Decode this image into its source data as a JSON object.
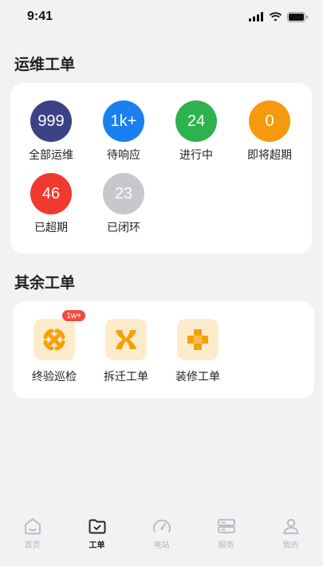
{
  "status_bar": {
    "time": "9:41"
  },
  "ops": {
    "title": "运维工单",
    "stats": [
      {
        "value": "999",
        "label": "全部运维",
        "color": "#3b4286"
      },
      {
        "value": "1k+",
        "label": "待响应",
        "color": "#1a7ff0"
      },
      {
        "value": "24",
        "label": "进行中",
        "color": "#2eb24d"
      },
      {
        "value": "0",
        "label": "即将超期",
        "color": "#f59a0c"
      },
      {
        "value": "46",
        "label": "已超期",
        "color": "#f03a2f"
      },
      {
        "value": "23",
        "label": "已闭环",
        "color": "#c7c7cc"
      }
    ]
  },
  "others": {
    "title": "其余工单",
    "items": [
      {
        "label": "终验巡检",
        "icon": "inspection-icon",
        "badge": "1w+"
      },
      {
        "label": "拆迁工单",
        "icon": "demolition-icon"
      },
      {
        "label": "装修工单",
        "icon": "renovation-icon"
      }
    ],
    "icon_color": "#f5a00b"
  },
  "tabs": [
    {
      "label": "首页",
      "icon": "home-icon"
    },
    {
      "label": "工单",
      "icon": "folder-check-icon",
      "active": true
    },
    {
      "label": "电站",
      "icon": "gauge-icon"
    },
    {
      "label": "服务",
      "icon": "server-icon"
    },
    {
      "label": "我的",
      "icon": "user-icon"
    }
  ]
}
